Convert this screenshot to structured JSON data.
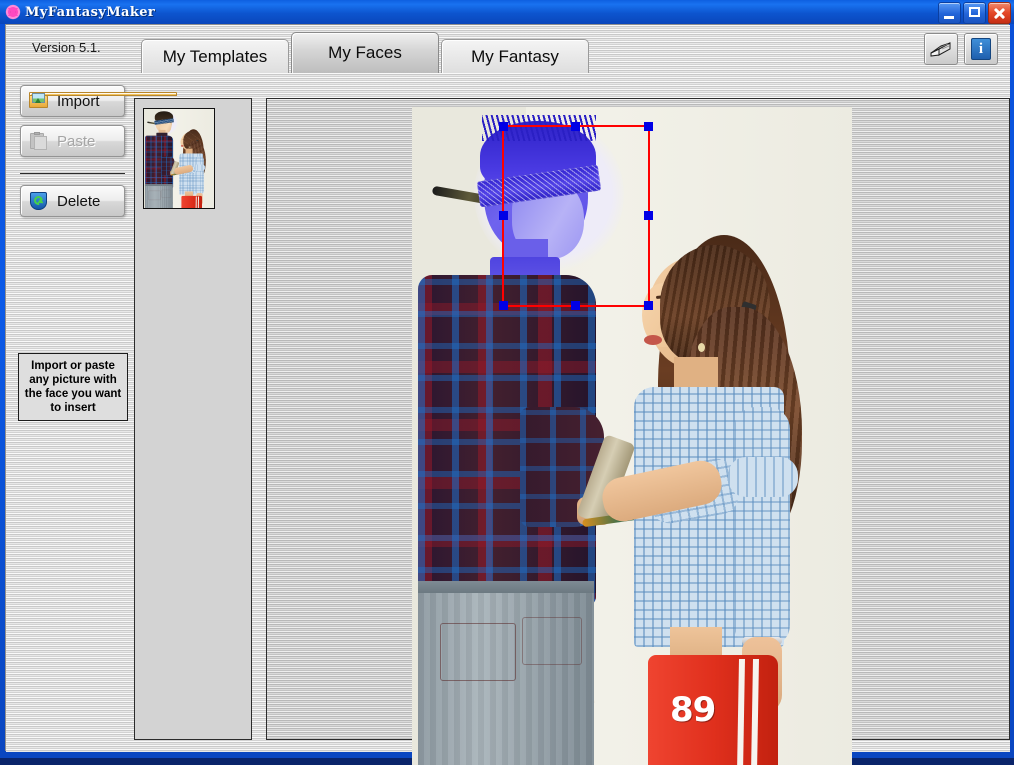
{
  "window": {
    "title": "MyFantasyMaker",
    "icon": "starburst-icon",
    "buttons": {
      "minimize": "minimize-icon",
      "maximize": "maximize-icon",
      "close": "close-icon"
    }
  },
  "header": {
    "version": "Version 5.1.",
    "tabs": [
      {
        "label": "My Templates",
        "active": false
      },
      {
        "label": "My Faces",
        "active": true
      },
      {
        "label": "My Fantasy",
        "active": false
      }
    ],
    "tools": [
      {
        "name": "help-book-button",
        "icon": "book-icon"
      },
      {
        "name": "info-button",
        "icon": "info-icon",
        "glyph": "i"
      }
    ]
  },
  "sidebar": {
    "buttons": [
      {
        "label": "Import",
        "icon": "folder-image-icon",
        "disabled": false
      },
      {
        "label": "Paste",
        "icon": "clipboard-icon",
        "disabled": true
      },
      {
        "label": "Delete",
        "icon": "recycle-shield-icon",
        "disabled": false
      }
    ],
    "hint": "Import or paste any picture with the face you want to insert"
  },
  "thumbnails": {
    "items": [
      {
        "name": "face-thumbnail-1",
        "selected": true,
        "alt": "couple photo thumbnail"
      }
    ]
  },
  "preview": {
    "alt": "man and woman facing each other with ladder and paint roller",
    "selection": {
      "label": "face-selection-box",
      "border_color": "#ff0000",
      "handle_color": "#0000e6",
      "handles": 8
    },
    "pants_number": "89"
  },
  "colors": {
    "titlebar_blue": "#0a4fd6",
    "selection_red": "#ff0000",
    "selection_handle_blue": "#0000e6",
    "panel_gray": "#d6d6d6",
    "close_red": "#e4492a"
  }
}
